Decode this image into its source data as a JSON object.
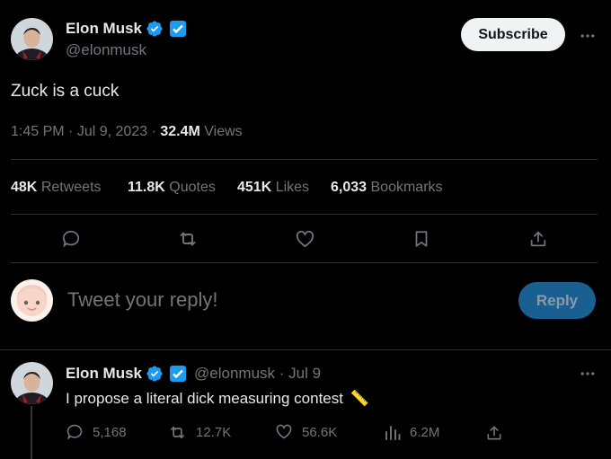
{
  "tweet": {
    "author_name": "Elon Musk",
    "handle": "@elonmusk",
    "subscribe_label": "Subscribe",
    "text": "Zuck is a cuck",
    "time": "1:45 PM",
    "date": "Jul 9, 2023",
    "views_count": "32.4M",
    "views_label": "Views",
    "separator": "·",
    "stats": [
      {
        "count": "48K",
        "label": "Retweets"
      },
      {
        "count": "11.8K",
        "label": "Quotes"
      },
      {
        "count": "451K",
        "label": "Likes"
      },
      {
        "count": "6,033",
        "label": "Bookmarks"
      }
    ]
  },
  "reply_box": {
    "placeholder": "Tweet your reply!",
    "button_label": "Reply"
  },
  "reply": {
    "author_name": "Elon Musk",
    "handle_date": "@elonmusk · Jul 9",
    "text": "I propose a literal dick measuring contest",
    "emoji": "📏",
    "actions": {
      "comments": "5,168",
      "retweets": "12.7K",
      "likes": "56.6K",
      "views": "6.2M"
    }
  },
  "icons": [
    "verified-badge-icon",
    "x-premium-badge-icon",
    "more-icon",
    "reply-icon",
    "retweet-icon",
    "like-icon",
    "bookmark-icon",
    "share-icon",
    "views-icon"
  ],
  "colors": {
    "background": "#000000",
    "text": "#e7e9ea",
    "muted": "#71767b",
    "divider": "#2f3336",
    "verified": "#1d9bf0",
    "reply_button": "#1a5f91"
  }
}
